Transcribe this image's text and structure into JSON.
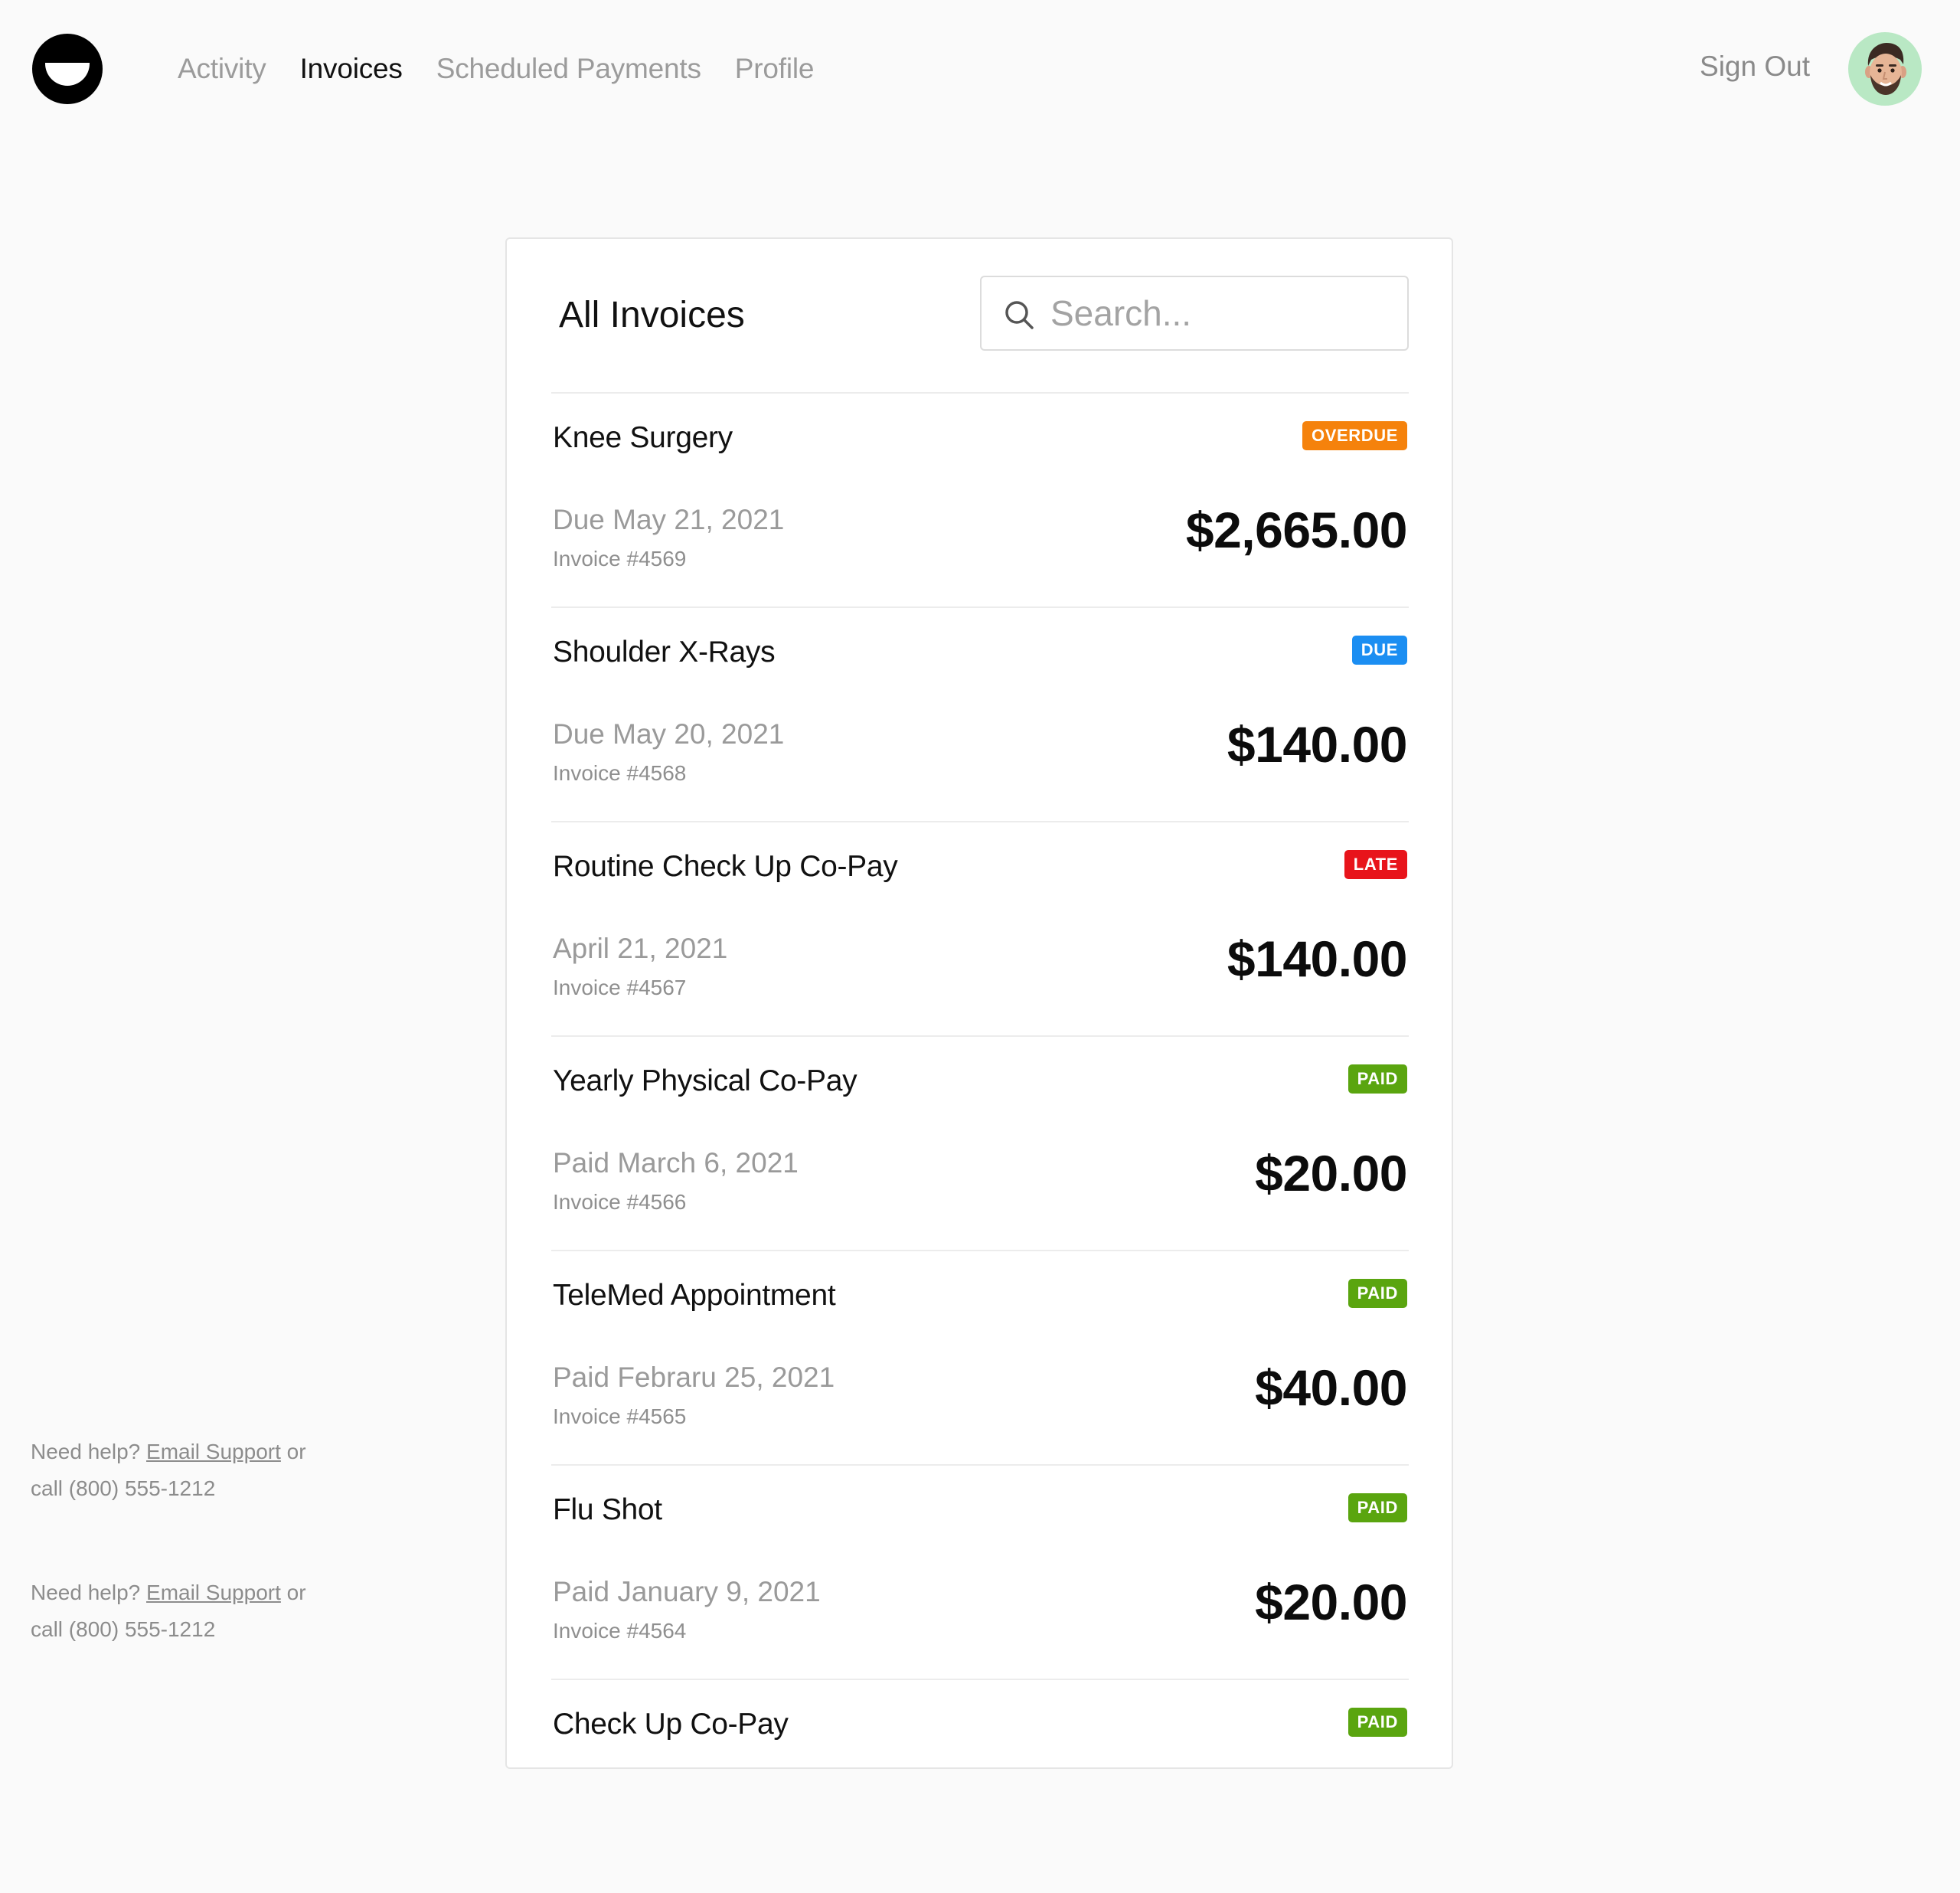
{
  "nav": {
    "items": [
      {
        "label": "Activity",
        "active": false
      },
      {
        "label": "Invoices",
        "active": true
      },
      {
        "label": "Scheduled Payments",
        "active": false
      },
      {
        "label": "Profile",
        "active": false
      }
    ],
    "sign_out": "Sign Out"
  },
  "invoices": {
    "title": "All Invoices",
    "search_placeholder": "Search...",
    "search_value": "",
    "rows": [
      {
        "title": "Knee Surgery",
        "status": "OVERDUE",
        "status_color": "#f5820c",
        "date": "Due May 21, 2021",
        "invoice": "Invoice #4569",
        "amount": "$2,665.00"
      },
      {
        "title": "Shoulder X-Rays",
        "status": "DUE",
        "status_color": "#1b8ef2",
        "date": "Due May 20, 2021",
        "invoice": "Invoice #4568",
        "amount": "$140.00"
      },
      {
        "title": "Routine Check Up Co-Pay",
        "status": "LATE",
        "status_color": "#e8141b",
        "date": "April 21, 2021",
        "invoice": "Invoice #4567",
        "amount": "$140.00"
      },
      {
        "title": "Yearly Physical Co-Pay",
        "status": "PAID",
        "status_color": "#5aa50f",
        "date": "Paid March 6, 2021",
        "invoice": "Invoice #4566",
        "amount": "$20.00"
      },
      {
        "title": "TeleMed Appointment",
        "status": "PAID",
        "status_color": "#5aa50f",
        "date": "Paid Febraru 25, 2021",
        "invoice": "Invoice #4565",
        "amount": "$40.00"
      },
      {
        "title": "Flu Shot",
        "status": "PAID",
        "status_color": "#5aa50f",
        "date": "Paid January 9, 2021",
        "invoice": "Invoice #4564",
        "amount": "$20.00"
      },
      {
        "title": "Check Up Co-Pay",
        "status": "PAID",
        "status_color": "#5aa50f",
        "date": "",
        "invoice": "",
        "amount": ""
      }
    ]
  },
  "help": {
    "prefix": "Need help?",
    "link": "Email Support",
    "middle": "or",
    "phone": "call (800) 555-1212"
  },
  "icons": {
    "logo": "smile-logo-icon",
    "search": "search-icon",
    "avatar": "memoji-avatar"
  }
}
